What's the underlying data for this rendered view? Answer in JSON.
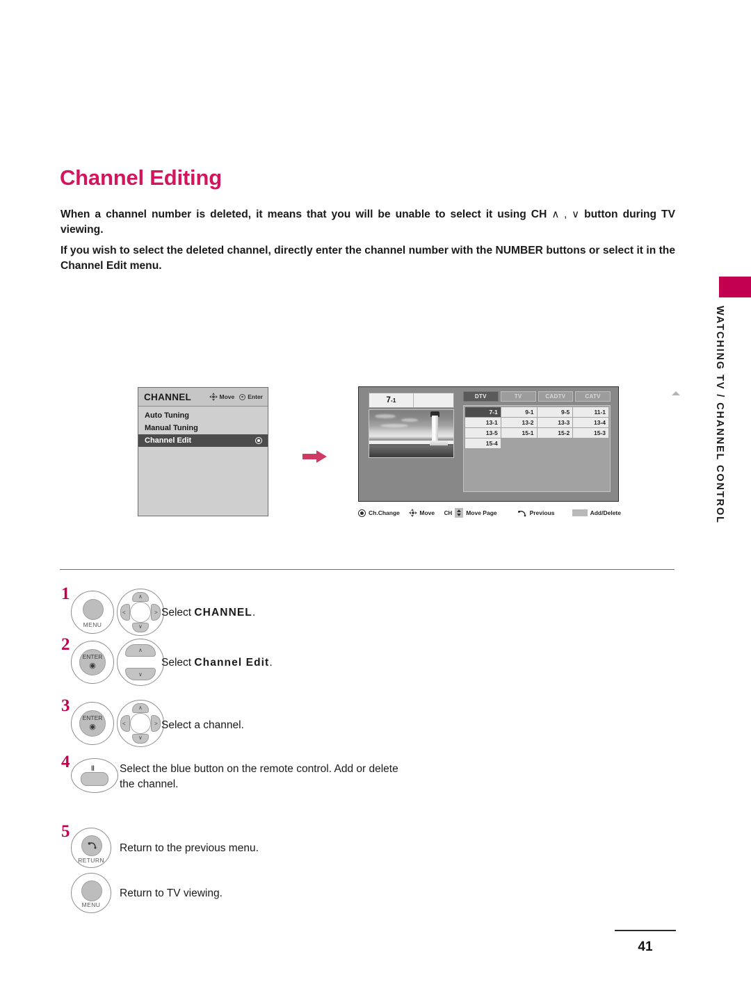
{
  "document": {
    "title": "Channel Editing",
    "page_number": "41",
    "side_tab_label": "WATCHING TV / CHANNEL CONTROL",
    "accent_color": "#c2004f",
    "title_color": "#d3155e"
  },
  "intro": {
    "paragraph_1_before": "When a channel number is deleted, it means that you will be unable to select it using CH ",
    "paragraph_1_arrows": "∧ , ∨",
    "paragraph_1_after": " button during TV viewing.",
    "paragraph_2": "If you wish to select the deleted channel, directly enter the channel number with the NUMBER buttons or select it in the Channel Edit menu."
  },
  "osd_channel_menu": {
    "header_title": "CHANNEL",
    "hint_move_label": "Move",
    "hint_move_icon": "dpad-move-icon",
    "hint_enter_label": "Enter",
    "hint_enter_icon": "enter-dot-icon",
    "items": [
      {
        "label": "Auto Tuning",
        "selected": false
      },
      {
        "label": "Manual Tuning",
        "selected": false
      },
      {
        "label": "Channel Edit",
        "selected": true
      }
    ]
  },
  "flow_arrow": {
    "icon": "right-arrow-icon",
    "color": "#cf3a63"
  },
  "osd_channel_edit": {
    "preview_channel": "7",
    "preview_channel_sub": "-1",
    "preview_image_alt": "lighthouse-photo",
    "tabs": [
      {
        "label": "DTV",
        "active": true
      },
      {
        "label": "TV",
        "active": false
      },
      {
        "label": "CADTV",
        "active": false
      },
      {
        "label": "CATV",
        "active": false
      }
    ],
    "channels": [
      {
        "label": "7-1",
        "selected": true
      },
      {
        "label": "9-1",
        "selected": false
      },
      {
        "label": "9-5",
        "selected": false
      },
      {
        "label": "11-1",
        "selected": false
      },
      {
        "label": "13-1",
        "selected": false
      },
      {
        "label": "13-2",
        "selected": false
      },
      {
        "label": "13-3",
        "selected": false
      },
      {
        "label": "13-4",
        "selected": false
      },
      {
        "label": "13-5",
        "selected": false
      },
      {
        "label": "15-1",
        "selected": false
      },
      {
        "label": "15-2",
        "selected": false
      },
      {
        "label": "15-3",
        "selected": false
      },
      {
        "label": "15-4",
        "selected": false
      }
    ],
    "toolbar": {
      "ch_change_label": "Ch.Change",
      "ch_change_icon": "filled-circle-icon",
      "move_label": "Move",
      "move_icon": "dpad-move-icon",
      "move_page_prefix": "CH",
      "move_page_label": "Move Page",
      "move_page_icon": "up-down-arrows-icon",
      "previous_label": "Previous",
      "previous_icon": "return-arrow-icon",
      "add_delete_label": "Add/Delete",
      "add_delete_icon": "blue-button-swatch-icon"
    }
  },
  "steps": [
    {
      "number": "1",
      "button_label": "MENU",
      "button_icon": "menu-button-icon",
      "control_icon": "dpad-4way-icon",
      "text_prefix": "Select ",
      "text_bold": "CHANNEL",
      "text_suffix": "."
    },
    {
      "number": "2",
      "button_label": "ENTER",
      "button_icon": "enter-button-icon",
      "control_icon": "dpad-updown-icon",
      "text_prefix": "Select ",
      "text_bold": "Channel Edit",
      "text_suffix": "."
    },
    {
      "number": "3",
      "button_label": "ENTER",
      "button_icon": "enter-button-icon",
      "control_icon": "dpad-4way-icon",
      "text_prefix": "Select a channel.",
      "text_bold": "",
      "text_suffix": ""
    },
    {
      "number": "4",
      "button_label": "",
      "button_icon": "blue-pause-button-icon",
      "control_icon": "",
      "text_prefix": "Select the blue button on the remote control. Add or delete the channel.",
      "text_bold": "",
      "text_suffix": ""
    },
    {
      "number": "5",
      "button_label": "RETURN",
      "button_icon": "return-button-icon",
      "control_icon": "",
      "text_prefix": "Return to the previous menu.",
      "text_bold": "",
      "text_suffix": ""
    },
    {
      "number": "",
      "button_label": "MENU",
      "button_icon": "menu-button-icon",
      "control_icon": "",
      "text_prefix": "Return to TV viewing.",
      "text_bold": "",
      "text_suffix": ""
    }
  ]
}
